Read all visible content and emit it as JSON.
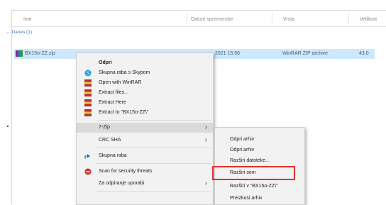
{
  "header": {
    "col_name": "Ime",
    "col_date": "Datum spremembe",
    "col_type": "Vrsta",
    "col_size": "Velikost"
  },
  "group": {
    "label": "Danes (1)"
  },
  "file": {
    "name": "BX15o-ZZ.zip",
    "date": "2021 15:56",
    "type": "WinRAR ZIP archive",
    "size": "43,0"
  },
  "context_menu": {
    "items": [
      {
        "label": "Odpri",
        "icon": "none",
        "bold": true
      },
      {
        "label": "Skupna raba s Skypom",
        "icon": "skype-icon"
      },
      {
        "label": "Open with WinRAR",
        "icon": "winrar-icon"
      },
      {
        "label": "Extract files...",
        "icon": "winrar-icon"
      },
      {
        "label": "Extract Here",
        "icon": "winrar-icon"
      },
      {
        "label": "Extract to \"BX15o-ZZ\\\"",
        "icon": "winrar-icon"
      },
      {
        "label": "7-Zip",
        "icon": "none",
        "submenu": true
      },
      {
        "label": "CRC SHA",
        "icon": "none",
        "submenu": true
      },
      {
        "label": "Skupna raba",
        "icon": "share-icon"
      },
      {
        "label": "Scan for security threats",
        "icon": "security-icon"
      },
      {
        "label": "Za odpiranje uporabi",
        "icon": "none",
        "submenu": true
      }
    ]
  },
  "submenu_7zip": {
    "items": [
      {
        "label": "Odpri arhiv"
      },
      {
        "label": "Odpri arhiv"
      },
      {
        "label": "Razširi datoteke..."
      },
      {
        "label": "Razširi sem"
      },
      {
        "label": "Razširi v \"BX15o-ZZ\\\""
      },
      {
        "label": "Preizkusi arhiv"
      }
    ],
    "highlighted_item": "Razširi sem"
  },
  "colors": {
    "selection": "#cce8ff",
    "highlight_border": "#e23030",
    "group_text": "#3b7ec7"
  }
}
